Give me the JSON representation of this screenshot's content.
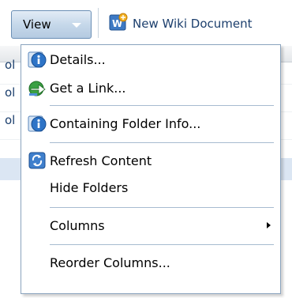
{
  "toolbar": {
    "view_label": "View",
    "new_wiki_label": "New Wiki Document"
  },
  "background": {
    "row_fragments": [
      "ol",
      "ol",
      "ol"
    ]
  },
  "menu": {
    "items": [
      {
        "label": "Details...",
        "icon": "info-icon"
      },
      {
        "label": "Get a Link...",
        "icon": "link-arrow-icon"
      },
      {
        "label": "Containing Folder Info...",
        "icon": "info-icon"
      },
      {
        "label": "Refresh Content",
        "icon": "refresh-icon"
      },
      {
        "label": "Hide Folders",
        "icon": ""
      },
      {
        "label": "Columns",
        "icon": "",
        "submenu": true
      },
      {
        "label": "Reorder Columns...",
        "icon": ""
      }
    ]
  },
  "colors": {
    "button_border": "#6b8fb5",
    "menu_border": "#8aa3bd",
    "separator": "#a7bbd0",
    "link_text": "#1c3f6d",
    "selected_row": "#dbe6f3"
  }
}
